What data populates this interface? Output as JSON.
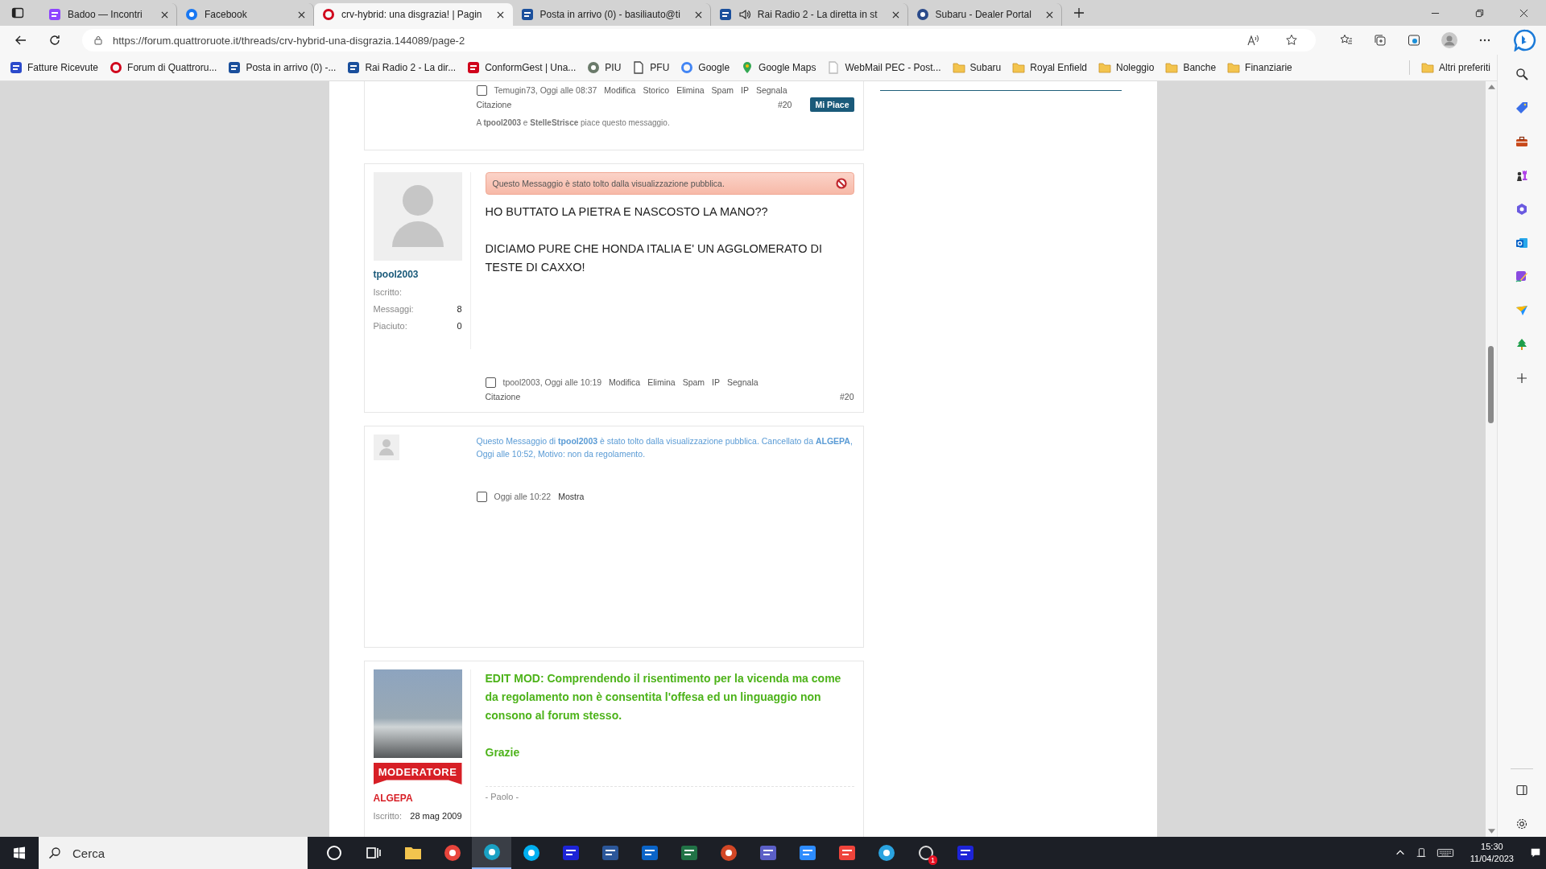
{
  "browser": {
    "tabs": [
      {
        "title": "Badoo — Incontri",
        "kind": "badoo",
        "selected": false,
        "audio": false
      },
      {
        "title": "Facebook",
        "kind": "facebook",
        "selected": false,
        "audio": false
      },
      {
        "title": "crv-hybrid: una disgrazia! | Pagin",
        "kind": "quattroruote",
        "selected": true,
        "audio": false
      },
      {
        "title": "Posta in arrivo (0) - basiliauto@ti",
        "kind": "mail",
        "selected": false,
        "audio": false
      },
      {
        "title": "Rai Radio 2 - La diretta in st",
        "kind": "rai",
        "selected": false,
        "audio": true
      },
      {
        "title": "Subaru - Dealer Portal",
        "kind": "globe",
        "selected": false,
        "audio": false
      }
    ],
    "url": "https://forum.quattroruote.it/threads/crv-hybrid-una-disgrazia.144089/page-2",
    "bookmarks": [
      {
        "label": "Fatture Ricevute",
        "kind": "doc"
      },
      {
        "label": "Forum di Quattroru...",
        "kind": "quattroruote"
      },
      {
        "label": "Posta in arrivo (0) -...",
        "kind": "mail"
      },
      {
        "label": "Rai Radio 2 - La dir...",
        "kind": "rai"
      },
      {
        "label": "ConformGest | Una...",
        "kind": "conform"
      },
      {
        "label": "PIU",
        "kind": "piu"
      },
      {
        "label": "PFU",
        "kind": "page"
      },
      {
        "label": "Google",
        "kind": "google"
      },
      {
        "label": "Google Maps",
        "kind": "maps"
      },
      {
        "label": "WebMail PEC - Post...",
        "kind": "webmail"
      },
      {
        "label": "Subaru",
        "kind": "folder"
      },
      {
        "label": "Royal Enfield",
        "kind": "folder"
      },
      {
        "label": "Noleggio",
        "kind": "folder"
      },
      {
        "label": "Banche",
        "kind": "folder"
      },
      {
        "label": "Finanziarie",
        "kind": "folder"
      }
    ],
    "other_bookmarks": "Altri preferiti"
  },
  "posts": [
    {
      "kind": "partial",
      "footer": {
        "checked": false,
        "meta": "Temugin73, Oggi alle 08:37",
        "actions": [
          "Modifica",
          "Storico",
          "Elimina",
          "Spam",
          "IP",
          "Segnala"
        ],
        "quote": "Citazione",
        "number": "#20",
        "like_button": "Mi Piace"
      },
      "likes": "A **tpool2003** e **StelleStrisce** piace questo messaggio."
    },
    {
      "kind": "full",
      "user": {
        "name": "tpool2003",
        "moderator": false,
        "photo": false,
        "stats": [
          {
            "label": "Iscritto:"
          },
          {
            "label": "Messaggi:",
            "value": "8"
          },
          {
            "label": "Piaciuto:",
            "value": "0"
          }
        ]
      },
      "notice": "Questo Messaggio è stato tolto dalla visualizzazione pubblica.",
      "body": [
        "HO BUTTATO LA PIETRA E NASCOSTO LA MANO??",
        "DICIAMO PURE CHE HONDA ITALIA E' UN AGGLOMERATO DI TESTE DI CAXXO!"
      ],
      "footer": {
        "checked": false,
        "meta": "tpool2003, Oggi alle 10:19",
        "actions": [
          "Modifica",
          "Elimina",
          "Spam",
          "IP",
          "Segnala"
        ],
        "quote": "Citazione",
        "number": "#20"
      }
    },
    {
      "kind": "deleted",
      "notice": "Questo Messaggio di **tpool2003** è stato tolto dalla visualizzazione pubblica. Cancellato da **ALGEPA**, Oggi alle 10:52, Motivo: non da regolamento.",
      "footer": {
        "checked": false,
        "meta": "Oggi alle 10:22",
        "show": "Mostra"
      }
    },
    {
      "kind": "full",
      "user": {
        "name": "ALGEPA",
        "moderator": true,
        "photo": true,
        "badge": "MODERATORE",
        "stats": [
          {
            "label": "Iscritto:",
            "value": "28 mag 2009"
          }
        ]
      },
      "body": [
        "EDIT MOD: Comprendendo il risentimento per la vicenda ma come da regolamento non è consentita l'offesa ed un linguaggio non consono al forum stesso.",
        "Grazie"
      ],
      "signature": "- Paolo -"
    }
  ],
  "taskbar": {
    "search_placeholder": "Cerca",
    "apps": [
      {
        "kind": "cortana",
        "selected": false
      },
      {
        "kind": "taskview",
        "selected": false
      },
      {
        "kind": "explorer",
        "selected": false
      },
      {
        "kind": "chrome",
        "selected": false
      },
      {
        "kind": "edge",
        "selected": true
      },
      {
        "kind": "skype",
        "selected": false
      },
      {
        "kind": "bcn",
        "selected": false
      },
      {
        "kind": "word",
        "selected": false
      },
      {
        "kind": "outlook",
        "selected": false
      },
      {
        "kind": "excel",
        "selected": false
      },
      {
        "kind": "powerpoint",
        "selected": false
      },
      {
        "kind": "teams",
        "selected": false
      },
      {
        "kind": "zoom",
        "selected": false
      },
      {
        "kind": "anydesk",
        "selected": false
      },
      {
        "kind": "telegram",
        "selected": false
      },
      {
        "kind": "whatsapp",
        "selected": false,
        "badge": "1"
      },
      {
        "kind": "bcn",
        "selected": false
      }
    ],
    "time": "15:30",
    "date": "11/04/2023"
  }
}
